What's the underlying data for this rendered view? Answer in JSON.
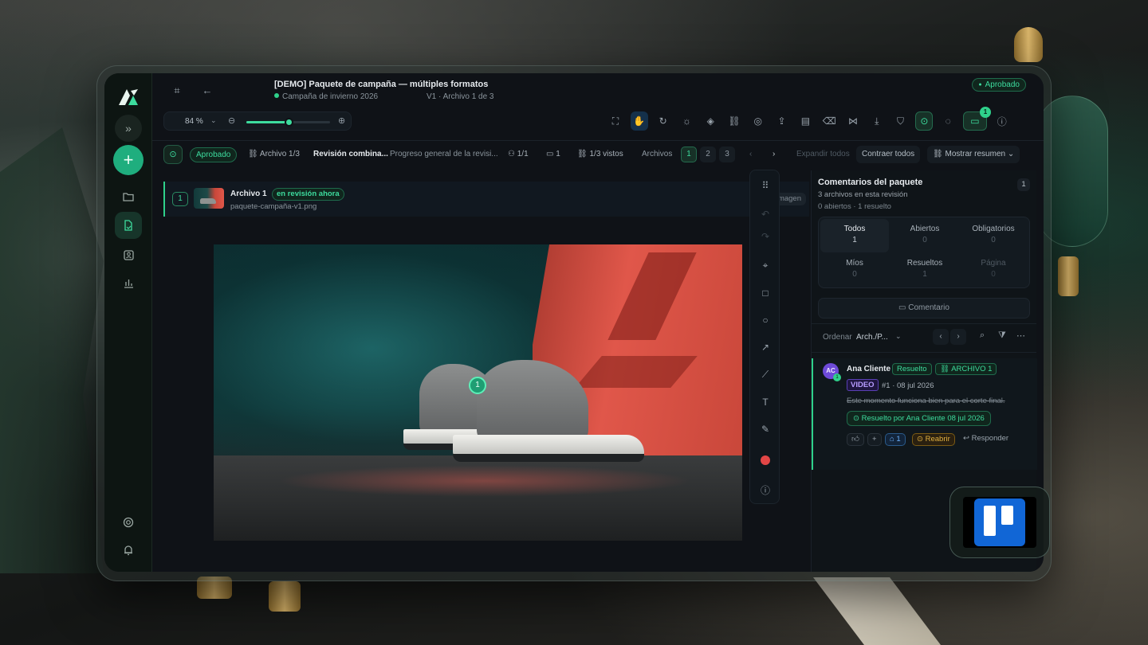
{
  "header": {
    "title": "[DEMO] Paquete de campaña — múltiples formatos",
    "campaign": "Campaña de invierno 2026",
    "version": "V1 · Archivo 1 de 3",
    "status": "Aprobado"
  },
  "toolbar": {
    "zoom": "84 %",
    "zoom_level": 0.5,
    "chat_badge": "1",
    "icons": [
      "fit-icon",
      "hand-icon",
      "rotate-icon",
      "brightness-icon",
      "layers-icon",
      "link-icon",
      "compass-icon",
      "upload-icon",
      "file-icon",
      "trash-icon",
      "share-icon",
      "download-icon",
      "shield-icon",
      "approve-icon",
      "explore-icon",
      "chat-icon",
      "info-icon"
    ]
  },
  "filters": {
    "status": "Aprobado",
    "archivo": "Archivo 1/3",
    "revision": "Revisión combina...",
    "progress": "Progreso general de la revisi...",
    "reviewers": "1/1",
    "comments": "1",
    "views": "1/3 vistos",
    "files_label": "Archivos",
    "pages": [
      "1",
      "2",
      "3"
    ],
    "current_page": "1",
    "expand_all": "Expandir todos",
    "collapse_all": "Contraer todos",
    "summary": "Mostrar resumen"
  },
  "file": {
    "number": "1",
    "name": "Archivo 1",
    "status": "en revisión ahora",
    "path": "paquete-campaña-v1.png",
    "type": "Imagen"
  },
  "canvas": {
    "pin": "1"
  },
  "panel": {
    "title": "Comentarios del paquete",
    "files_info": "3 archivos en esta revisión",
    "open_info": "0 abiertos · 1 resuelto",
    "count": "1",
    "stats": [
      {
        "label": "Todos",
        "value": "1"
      },
      {
        "label": "Abiertos",
        "value": "0"
      },
      {
        "label": "Obligatorios",
        "value": "0"
      },
      {
        "label": "Míos",
        "value": "0"
      },
      {
        "label": "Resueltos",
        "value": "1"
      },
      {
        "label": "Página",
        "value": "0"
      }
    ],
    "comment_button": "Comentario",
    "order_label": "Ordenar",
    "order_value": "Arch./P..."
  },
  "comment": {
    "initials": "AC",
    "mini": "1",
    "author": "Ana Cliente",
    "resolved_tag": "Resuelto",
    "file_tag": "ARCHIVO 1",
    "type": "VIDEO",
    "meta": "#1 · 08 jul 2026",
    "text": "Este momento funciona bien para el corte final.",
    "resolved_by": "Resuelto por Ana Cliente 08 jul 2026",
    "tags_count": "1",
    "reopen": "Reabrir",
    "reply": "Responder"
  }
}
